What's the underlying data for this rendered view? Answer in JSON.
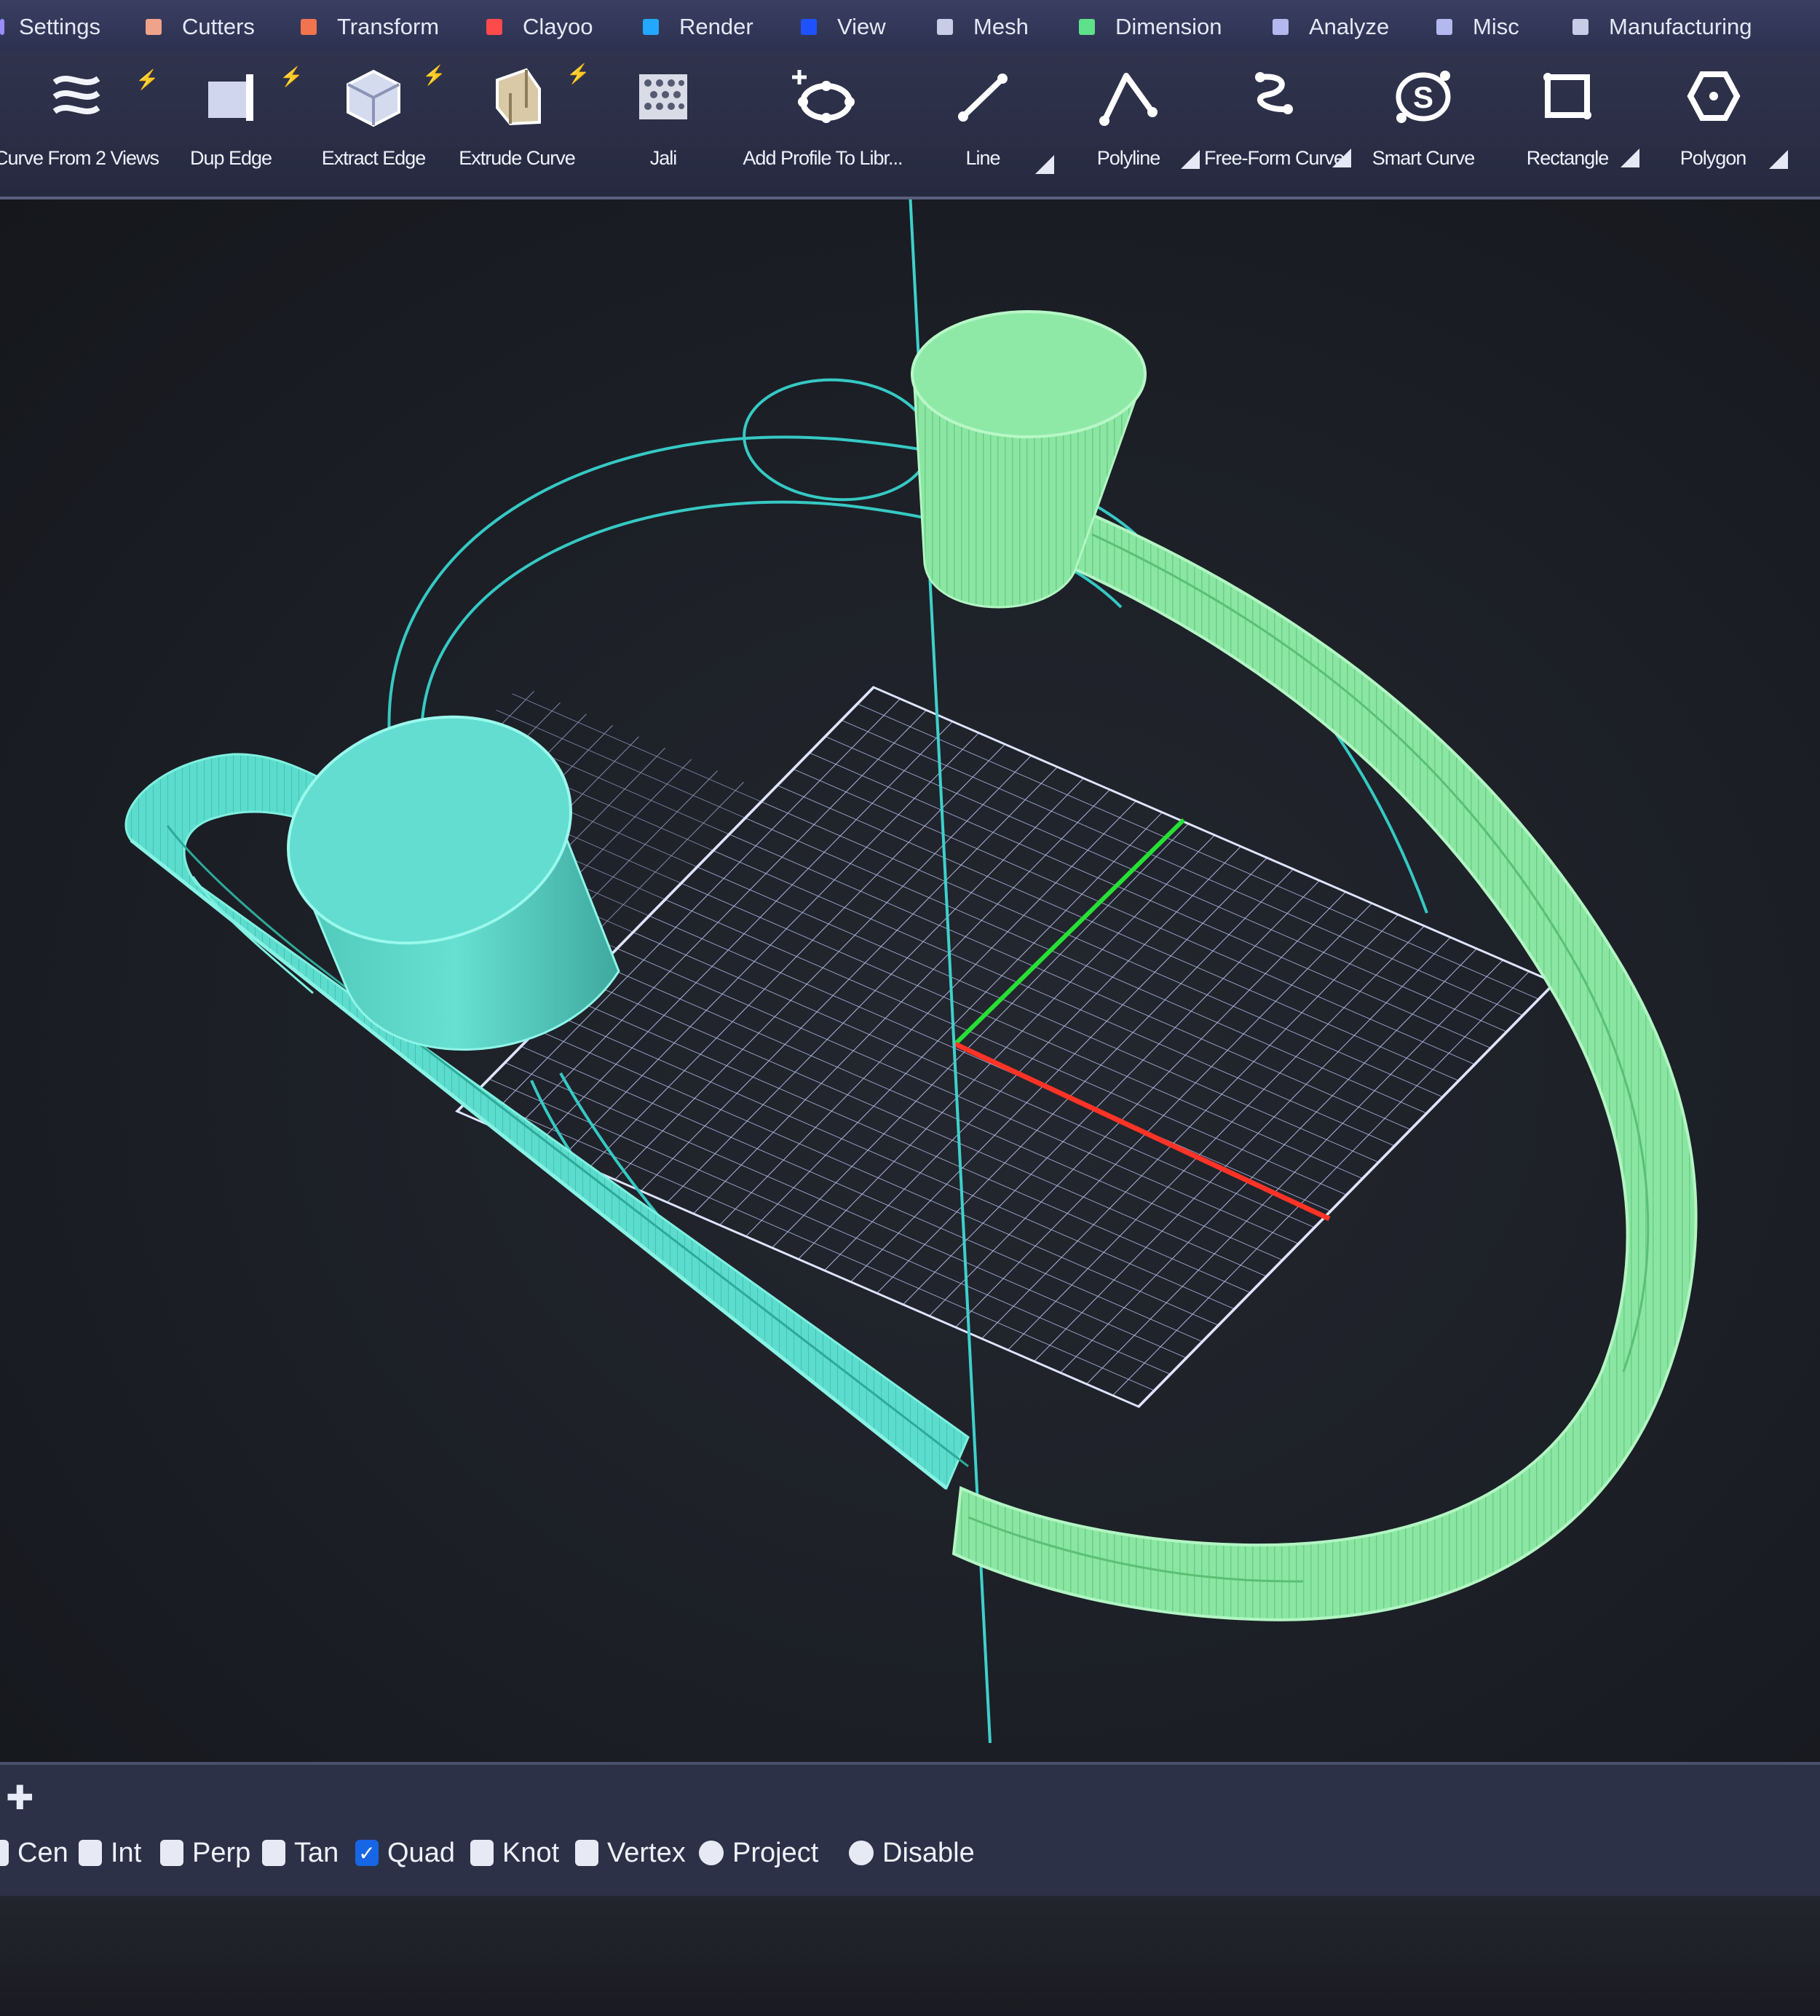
{
  "tabs": [
    {
      "label": "Settings",
      "color": "#9b8cff"
    },
    {
      "label": "Cutters",
      "color": "#f0a38a"
    },
    {
      "label": "Transform",
      "color": "#f2744e"
    },
    {
      "label": "Clayoo",
      "color": "#ff4a4a"
    },
    {
      "label": "Render",
      "color": "#22a8ff"
    },
    {
      "label": "View",
      "color": "#1f52ff"
    },
    {
      "label": "Mesh",
      "color": "#c9cce6"
    },
    {
      "label": "Dimension",
      "color": "#5fe08a"
    },
    {
      "label": "Analyze",
      "color": "#b3b9ee"
    },
    {
      "label": "Misc",
      "color": "#b3b9ee"
    },
    {
      "label": "Manufacturing",
      "color": "#c8cce6"
    }
  ],
  "tools": [
    {
      "label": "Curve From 2 Views",
      "icon": "curve-from-2-views-icon"
    },
    {
      "label": "Dup Edge",
      "icon": "dup-edge-icon"
    },
    {
      "label": "Extract Edge",
      "icon": "extract-edge-icon"
    },
    {
      "label": "Extrude Curve",
      "icon": "extrude-curve-icon"
    },
    {
      "label": "Jali",
      "icon": "jali-icon"
    },
    {
      "label": "Add Profile To Libr...",
      "icon": "add-profile-icon"
    },
    {
      "label": "Line",
      "icon": "line-icon"
    },
    {
      "label": "Polyline",
      "icon": "polyline-icon"
    },
    {
      "label": "Free-Form Curve",
      "icon": "free-form-curve-icon"
    },
    {
      "label": "Smart Curve",
      "icon": "smart-curve-icon"
    },
    {
      "label": "Rectangle",
      "icon": "rectangle-icon"
    },
    {
      "label": "Polygon",
      "icon": "polygon-icon"
    }
  ],
  "snaps": [
    {
      "label": "Cen",
      "checked": false
    },
    {
      "label": "Int",
      "checked": false
    },
    {
      "label": "Perp",
      "checked": false
    },
    {
      "label": "Tan",
      "checked": false
    },
    {
      "label": "Quad",
      "checked": true
    },
    {
      "label": "Knot",
      "checked": false
    },
    {
      "label": "Vertex",
      "checked": false
    },
    {
      "label": "Project",
      "checked": false
    },
    {
      "label": "Disable",
      "checked": false
    }
  ],
  "colors": {
    "ring_green": "#86e8a0",
    "ring_teal": "#5fe0d0",
    "curve_cyan": "#36c9c4",
    "grid": "#c7cfff",
    "axis_x": "#ff3326",
    "axis_y": "#27e035",
    "checkbox_on": "#1766e6"
  }
}
